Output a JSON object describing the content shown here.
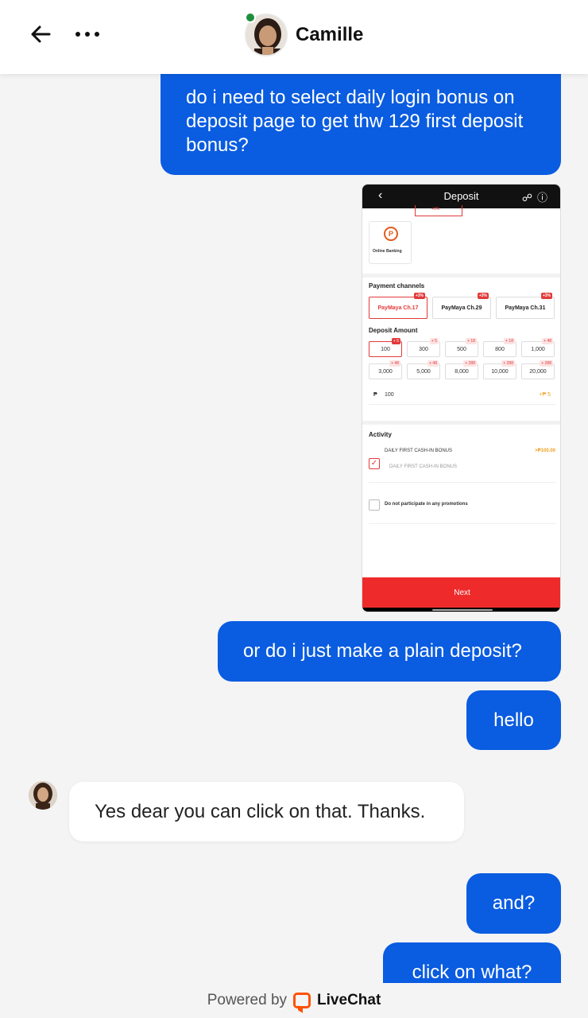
{
  "header": {
    "agent_name": "Camille",
    "back_icon": "arrow-left-icon",
    "more_icon": "more-dots-icon",
    "status_color": "#1e8e3e"
  },
  "messages": [
    {
      "from": "user",
      "text": "do i need to select daily login bonus on deposit page to get thw 129 first deposit bonus?"
    },
    {
      "from": "user",
      "text": "or do i just make a plain deposit?"
    },
    {
      "from": "user",
      "text": "hello"
    },
    {
      "from": "agent",
      "text": "Yes dear you can click on that. Thanks."
    },
    {
      "from": "user",
      "text": "and?"
    },
    {
      "from": "user",
      "text": "click on what?"
    }
  ],
  "attachment": {
    "title": "Deposit",
    "top_tag": "+3%",
    "online_banking": "Online Banking",
    "online_banking_icon": "P",
    "payment_channels_label": "Payment channels",
    "channels": [
      {
        "label": "PayMaya Ch.17",
        "tag": "+3%"
      },
      {
        "label": "PayMaya Ch.29",
        "tag": "+3%"
      },
      {
        "label": "PayMaya Ch.31",
        "tag": "+3%"
      }
    ],
    "deposit_amount_label": "Deposit Amount",
    "amounts": [
      {
        "value": "100",
        "tag": "+ 5"
      },
      {
        "value": "300",
        "tag": "+ 5"
      },
      {
        "value": "500",
        "tag": "+ 18"
      },
      {
        "value": "800",
        "tag": "+ 18"
      },
      {
        "value": "1,000",
        "tag": "+ 48"
      },
      {
        "value": "3,000",
        "tag": "+ 48"
      },
      {
        "value": "5,000",
        "tag": "+ 48"
      },
      {
        "value": "8,000",
        "tag": "+ 288"
      },
      {
        "value": "10,000",
        "tag": "+ 288"
      },
      {
        "value": "20,000",
        "tag": "+ 288"
      }
    ],
    "currency_symbol": "₱",
    "amount_input": "100",
    "amount_bonus": "+₱ 5",
    "activity_label": "Activity",
    "bonus_title": "DAILY FIRST CASH-IN BONUS",
    "bonus_amount": ">₱100.00",
    "bonus_option": "DAILY FIRST CASH-IN BONUS",
    "no_promo": "Do not participate in any promotions",
    "next_label": "Next",
    "accent": "#ee2a2a"
  },
  "footer": {
    "powered_by": "Powered by",
    "brand": "LiveChat",
    "brand_color": "#ff5100"
  },
  "colors": {
    "user_bubble": "#0a5ce0",
    "background": "#f4f4f5"
  }
}
